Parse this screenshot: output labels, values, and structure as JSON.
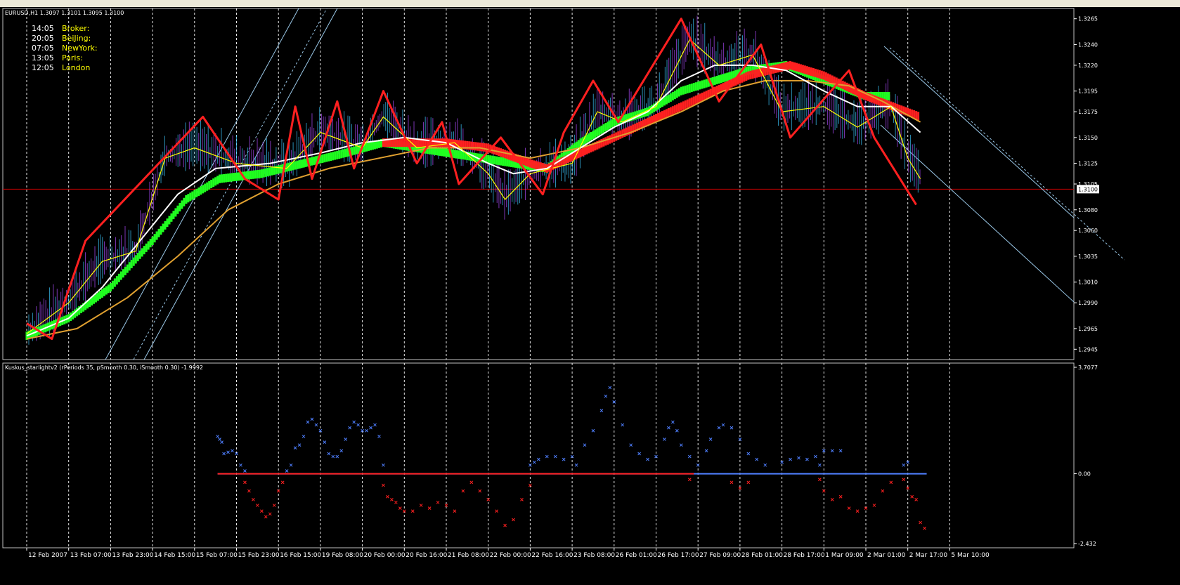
{
  "window": {
    "symbol_header": "EURUSD,H1  1.3097 1.3101 1.3095 1.3100"
  },
  "clocks": [
    {
      "time": "14:05",
      "label": "Broker:"
    },
    {
      "time": "20:05",
      "label": "BeiJing:"
    },
    {
      "time": "07:05",
      "label": "NewYork:"
    },
    {
      "time": "13:05",
      "label": "Paris:"
    },
    {
      "time": "12:05",
      "label": "London"
    }
  ],
  "indicator": {
    "header": "Kuskus_starlightv2  (rPeriods 35, pSmooth 0.30, iSmooth 0.30)   -1.9992"
  },
  "colors": {
    "background": "#000000",
    "grid": "#ffffff",
    "axis_text": "#ffffff",
    "price_line": "#cc0000",
    "zigzag": "#ff2020",
    "ma_white": "#ffffff",
    "ma_orange": "#e0a030",
    "ma_yellow": "#ffff00",
    "trend_green": "#20ff20",
    "trend_red": "#ff2020",
    "channel": "#9ac8e8",
    "osc_blue": "#4f7fff",
    "osc_red": "#ff2020"
  },
  "chart_data": [
    {
      "type": "line",
      "panel": "price",
      "price_axis_ticks": [
        "1.3265",
        "1.3240",
        "1.3220",
        "1.3195",
        "1.3175",
        "1.3150",
        "1.3125",
        "1.3105",
        "1.3100",
        "1.3080",
        "1.3060",
        "1.3035",
        "1.3010",
        "1.2990",
        "1.2965",
        "1.2945"
      ],
      "current_price": "1.3100",
      "ylim": [
        1.2935,
        1.3275
      ],
      "x_ticks": [
        "12 Feb 2007",
        "13 Feb 07:00",
        "13 Feb 23:00",
        "14 Feb 15:00",
        "15 Feb 07:00",
        "15 Feb 23:00",
        "16 Feb 15:00",
        "19 Feb 08:00",
        "20 Feb 00:00",
        "20 Feb 16:00",
        "21 Feb 08:00",
        "22 Feb 00:00",
        "22 Feb 16:00",
        "23 Feb 08:00",
        "26 Feb 01:00",
        "26 Feb 17:00",
        "27 Feb 09:00",
        "28 Feb 01:00",
        "28 Feb 17:00",
        "1 Mar 09:00",
        "2 Mar 01:00",
        "2 Mar 17:00",
        "5 Mar 10:00"
      ],
      "zigzag": [
        [
          0.0,
          1.297
        ],
        [
          0.6,
          1.2955
        ],
        [
          1.4,
          1.305
        ],
        [
          4.2,
          1.317
        ],
        [
          5.2,
          1.311
        ],
        [
          6.0,
          1.309
        ],
        [
          6.4,
          1.318
        ],
        [
          6.8,
          1.311
        ],
        [
          7.4,
          1.3185
        ],
        [
          7.8,
          1.312
        ],
        [
          8.5,
          1.3195
        ],
        [
          9.3,
          1.3125
        ],
        [
          9.9,
          1.3165
        ],
        [
          10.3,
          1.3105
        ],
        [
          11.3,
          1.315
        ],
        [
          12.3,
          1.3095
        ],
        [
          12.8,
          1.3155
        ],
        [
          13.5,
          1.3205
        ],
        [
          14.1,
          1.3165
        ],
        [
          15.6,
          1.3265
        ],
        [
          16.5,
          1.3185
        ],
        [
          17.5,
          1.324
        ],
        [
          18.2,
          1.315
        ],
        [
          19.6,
          1.3215
        ],
        [
          20.2,
          1.315
        ],
        [
          21.2,
          1.3085
        ]
      ],
      "ma_yellow": [
        [
          0.0,
          1.296
        ],
        [
          1.0,
          1.299
        ],
        [
          1.8,
          1.303
        ],
        [
          2.6,
          1.304
        ],
        [
          3.3,
          1.313
        ],
        [
          4.0,
          1.314
        ],
        [
          5.0,
          1.3125
        ],
        [
          6.2,
          1.312
        ],
        [
          7.0,
          1.3155
        ],
        [
          8.0,
          1.314
        ],
        [
          8.5,
          1.317
        ],
        [
          9.3,
          1.314
        ],
        [
          10.2,
          1.3145
        ],
        [
          11.0,
          1.3115
        ],
        [
          11.4,
          1.309
        ],
        [
          12.0,
          1.3115
        ],
        [
          13.0,
          1.3125
        ],
        [
          13.6,
          1.3175
        ],
        [
          14.2,
          1.3165
        ],
        [
          15.0,
          1.318
        ],
        [
          15.8,
          1.3245
        ],
        [
          16.5,
          1.322
        ],
        [
          17.3,
          1.323
        ],
        [
          18.0,
          1.3175
        ],
        [
          19.0,
          1.318
        ],
        [
          19.8,
          1.316
        ],
        [
          20.6,
          1.318
        ],
        [
          21.0,
          1.313
        ],
        [
          21.3,
          1.311
        ]
      ],
      "ma_white": [
        [
          0.0,
          1.2958
        ],
        [
          1.0,
          1.2975
        ],
        [
          1.8,
          1.3005
        ],
        [
          2.8,
          1.3055
        ],
        [
          3.6,
          1.3095
        ],
        [
          4.5,
          1.312
        ],
        [
          5.8,
          1.3125
        ],
        [
          7.0,
          1.3135
        ],
        [
          8.0,
          1.3145
        ],
        [
          9.0,
          1.315
        ],
        [
          10.0,
          1.3145
        ],
        [
          11.0,
          1.3125
        ],
        [
          11.6,
          1.3115
        ],
        [
          12.4,
          1.312
        ],
        [
          13.2,
          1.314
        ],
        [
          14.0,
          1.316
        ],
        [
          14.8,
          1.3175
        ],
        [
          15.6,
          1.3205
        ],
        [
          16.4,
          1.322
        ],
        [
          17.3,
          1.322
        ],
        [
          18.1,
          1.3215
        ],
        [
          19.0,
          1.3195
        ],
        [
          19.8,
          1.318
        ],
        [
          20.6,
          1.318
        ],
        [
          21.3,
          1.3155
        ]
      ],
      "ma_orange": [
        [
          0.0,
          1.2955
        ],
        [
          1.2,
          1.2965
        ],
        [
          2.4,
          1.2995
        ],
        [
          3.6,
          1.3035
        ],
        [
          4.8,
          1.308
        ],
        [
          6.0,
          1.3105
        ],
        [
          7.2,
          1.312
        ],
        [
          8.4,
          1.313
        ],
        [
          9.6,
          1.314
        ],
        [
          10.8,
          1.314
        ],
        [
          12.0,
          1.313
        ],
        [
          13.2,
          1.314
        ],
        [
          14.4,
          1.3155
        ],
        [
          15.6,
          1.3175
        ],
        [
          16.6,
          1.3195
        ],
        [
          17.6,
          1.3205
        ],
        [
          18.6,
          1.3205
        ],
        [
          19.6,
          1.32
        ],
        [
          20.4,
          1.3185
        ],
        [
          21.3,
          1.3165
        ]
      ],
      "trend_green": [
        [
          0.0,
          1.2958
        ],
        [
          1.0,
          1.2975
        ],
        [
          2.0,
          1.3005
        ],
        [
          3.0,
          1.305
        ],
        [
          3.8,
          1.309
        ],
        [
          4.6,
          1.311
        ],
        [
          5.6,
          1.3115
        ],
        [
          6.6,
          1.3125
        ],
        [
          7.6,
          1.3135
        ],
        [
          8.5,
          1.3145
        ],
        [
          12.4,
          1.312
        ],
        [
          13.2,
          1.3145
        ],
        [
          14.0,
          1.3165
        ],
        [
          14.8,
          1.3175
        ],
        [
          15.6,
          1.3195
        ],
        [
          16.4,
          1.3205
        ],
        [
          17.2,
          1.3215
        ],
        [
          18.1,
          1.322
        ],
        [
          20.0,
          1.319
        ],
        [
          20.6,
          1.319
        ]
      ],
      "trend_red": [
        [
          8.5,
          1.3145
        ],
        [
          10.0,
          1.3145
        ],
        [
          11.0,
          1.314
        ],
        [
          12.0,
          1.3125
        ],
        [
          12.4,
          1.312
        ],
        [
          17.2,
          1.321
        ],
        [
          18.2,
          1.322
        ],
        [
          19.0,
          1.321
        ],
        [
          20.0,
          1.319
        ],
        [
          21.3,
          1.317
        ]
      ]
    },
    {
      "type": "scatter",
      "panel": "oscillator",
      "name": "Kuskus_starlightv2",
      "ytick_labels": [
        "3.7077",
        "0.00",
        "-2.432"
      ],
      "ylim": [
        -2.432,
        3.7077
      ],
      "blue_points": [
        [
          4.55,
          1.3
        ],
        [
          4.6,
          1.2
        ],
        [
          4.65,
          1.1
        ],
        [
          4.7,
          0.7
        ],
        [
          4.8,
          0.75
        ],
        [
          4.9,
          0.8
        ],
        [
          5.0,
          0.7
        ],
        [
          5.1,
          0.3
        ],
        [
          5.2,
          0.1
        ],
        [
          6.2,
          0.1
        ],
        [
          6.3,
          0.3
        ],
        [
          6.4,
          0.9
        ],
        [
          6.5,
          1.0
        ],
        [
          6.6,
          1.3
        ],
        [
          6.7,
          1.8
        ],
        [
          6.8,
          1.9
        ],
        [
          6.9,
          1.7
        ],
        [
          7.0,
          1.5
        ],
        [
          7.1,
          1.1
        ],
        [
          7.2,
          0.7
        ],
        [
          7.3,
          0.6
        ],
        [
          7.4,
          0.6
        ],
        [
          7.5,
          0.8
        ],
        [
          7.6,
          1.2
        ],
        [
          7.7,
          1.6
        ],
        [
          7.8,
          1.8
        ],
        [
          7.9,
          1.7
        ],
        [
          8.0,
          1.5
        ],
        [
          8.1,
          1.5
        ],
        [
          8.2,
          1.6
        ],
        [
          8.3,
          1.7
        ],
        [
          8.4,
          1.3
        ],
        [
          8.5,
          0.3
        ],
        [
          12.0,
          0.3
        ],
        [
          12.1,
          0.4
        ],
        [
          12.2,
          0.5
        ],
        [
          12.4,
          0.6
        ],
        [
          12.6,
          0.6
        ],
        [
          12.8,
          0.5
        ],
        [
          13.0,
          0.6
        ],
        [
          13.1,
          0.3
        ],
        [
          13.3,
          1.0
        ],
        [
          13.5,
          1.5
        ],
        [
          13.7,
          2.2
        ],
        [
          13.8,
          2.7
        ],
        [
          13.9,
          3.0
        ],
        [
          14.0,
          2.5
        ],
        [
          14.2,
          1.7
        ],
        [
          14.4,
          1.0
        ],
        [
          14.6,
          0.7
        ],
        [
          14.8,
          0.5
        ],
        [
          15.0,
          0.6
        ],
        [
          15.2,
          1.2
        ],
        [
          15.3,
          1.6
        ],
        [
          15.4,
          1.8
        ],
        [
          15.5,
          1.5
        ],
        [
          15.6,
          1.0
        ],
        [
          15.8,
          0.6
        ],
        [
          16.0,
          0.3
        ],
        [
          16.2,
          0.8
        ],
        [
          16.3,
          1.2
        ],
        [
          16.5,
          1.6
        ],
        [
          16.6,
          1.7
        ],
        [
          16.8,
          1.6
        ],
        [
          17.0,
          1.2
        ],
        [
          17.2,
          0.7
        ],
        [
          17.4,
          0.5
        ],
        [
          17.6,
          0.3
        ],
        [
          18.0,
          0.4
        ],
        [
          18.2,
          0.5
        ],
        [
          18.4,
          0.55
        ],
        [
          18.6,
          0.5
        ],
        [
          18.8,
          0.6
        ],
        [
          18.9,
          0.3
        ],
        [
          19.0,
          0.8
        ],
        [
          19.2,
          0.8
        ],
        [
          19.4,
          0.8
        ],
        [
          20.9,
          0.3
        ],
        [
          21.0,
          0.4
        ]
      ],
      "red_points": [
        [
          5.2,
          -0.3
        ],
        [
          5.3,
          -0.6
        ],
        [
          5.4,
          -0.9
        ],
        [
          5.5,
          -1.1
        ],
        [
          5.6,
          -1.3
        ],
        [
          5.7,
          -1.5
        ],
        [
          5.8,
          -1.4
        ],
        [
          5.9,
          -1.1
        ],
        [
          6.0,
          -0.6
        ],
        [
          6.1,
          -0.3
        ],
        [
          8.5,
          -0.4
        ],
        [
          8.6,
          -0.8
        ],
        [
          8.7,
          -0.9
        ],
        [
          8.8,
          -1.0
        ],
        [
          8.9,
          -1.2
        ],
        [
          9.0,
          -1.3
        ],
        [
          9.2,
          -1.3
        ],
        [
          9.4,
          -1.1
        ],
        [
          9.6,
          -1.2
        ],
        [
          9.8,
          -1.0
        ],
        [
          10.0,
          -1.1
        ],
        [
          10.2,
          -1.3
        ],
        [
          10.4,
          -0.6
        ],
        [
          10.6,
          -0.3
        ],
        [
          10.8,
          -0.6
        ],
        [
          11.0,
          -0.9
        ],
        [
          11.2,
          -1.3
        ],
        [
          11.4,
          -1.8
        ],
        [
          11.6,
          -1.6
        ],
        [
          11.8,
          -0.9
        ],
        [
          12.0,
          -0.4
        ],
        [
          15.8,
          -0.2
        ],
        [
          16.8,
          -0.3
        ],
        [
          17.0,
          -0.5
        ],
        [
          17.2,
          -0.3
        ],
        [
          18.9,
          -0.2
        ],
        [
          19.0,
          -0.6
        ],
        [
          19.2,
          -0.9
        ],
        [
          19.4,
          -0.8
        ],
        [
          19.6,
          -1.2
        ],
        [
          19.8,
          -1.3
        ],
        [
          20.0,
          -1.2
        ],
        [
          20.2,
          -1.1
        ],
        [
          20.4,
          -0.6
        ],
        [
          20.6,
          -0.3
        ],
        [
          20.9,
          -0.2
        ],
        [
          21.0,
          -0.5
        ],
        [
          21.1,
          -0.8
        ],
        [
          21.2,
          -0.9
        ],
        [
          21.3,
          -1.7
        ],
        [
          21.4,
          -1.9
        ]
      ]
    }
  ]
}
